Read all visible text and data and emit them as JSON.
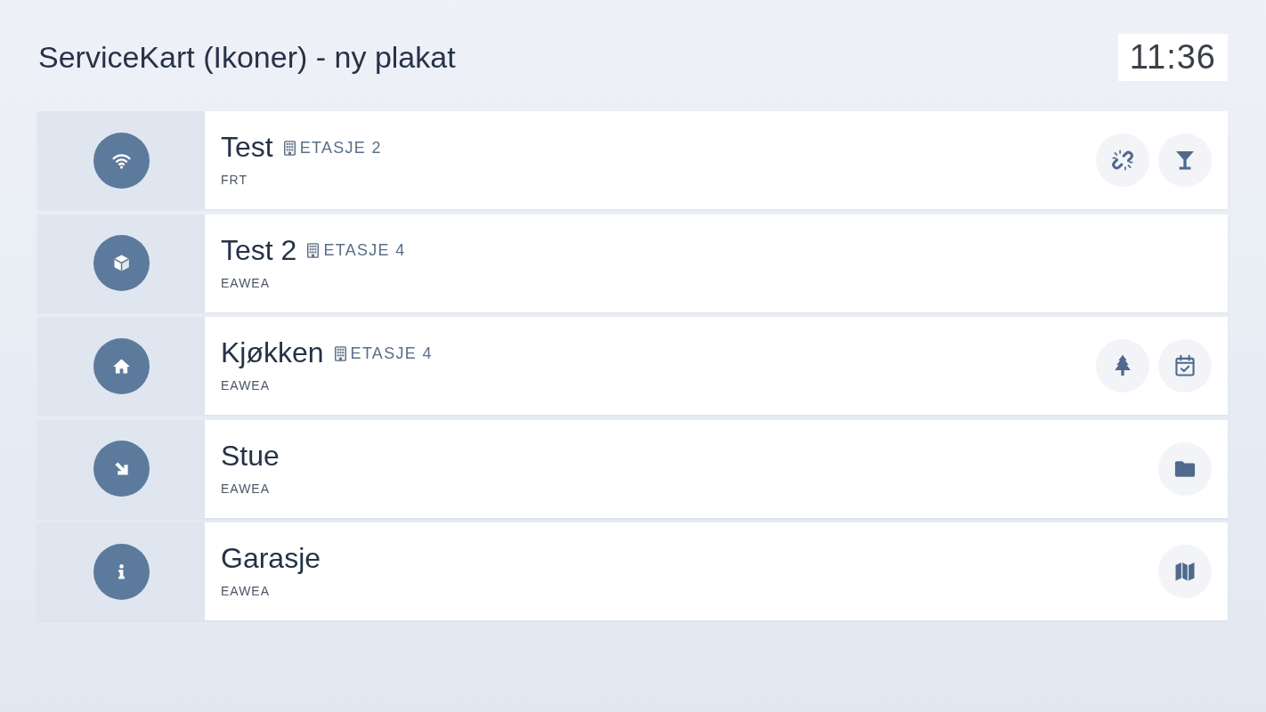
{
  "header": {
    "title": "ServiceKart (Ikoner) - ny plakat",
    "clock": "11:36"
  },
  "rows": [
    {
      "icon": {
        "kind": "wifi"
      },
      "name": "Test",
      "floor": "ETASJE 2",
      "subtitle": "FRT",
      "actions": [
        {
          "kind": "broken-link"
        },
        {
          "kind": "cocktail"
        }
      ]
    },
    {
      "icon": {
        "kind": "cube"
      },
      "name": "Test 2",
      "floor": "ETASJE 4",
      "subtitle": "EAWEA"
    },
    {
      "icon": {
        "kind": "house"
      },
      "name": "Kjøkken",
      "floor": "ETASJE 4",
      "subtitle": "EAWEA",
      "actions": [
        {
          "kind": "tree"
        },
        {
          "kind": "calendar-check"
        }
      ]
    },
    {
      "icon": {
        "kind": "arrow"
      },
      "name": "Stue",
      "subtitle": "EAWEA",
      "actions": [
        {
          "kind": "folder"
        }
      ]
    },
    {
      "icon": {
        "kind": "info"
      },
      "name": "Garasje",
      "subtitle": "EAWEA",
      "actions": [
        {
          "kind": "map"
        }
      ]
    }
  ]
}
